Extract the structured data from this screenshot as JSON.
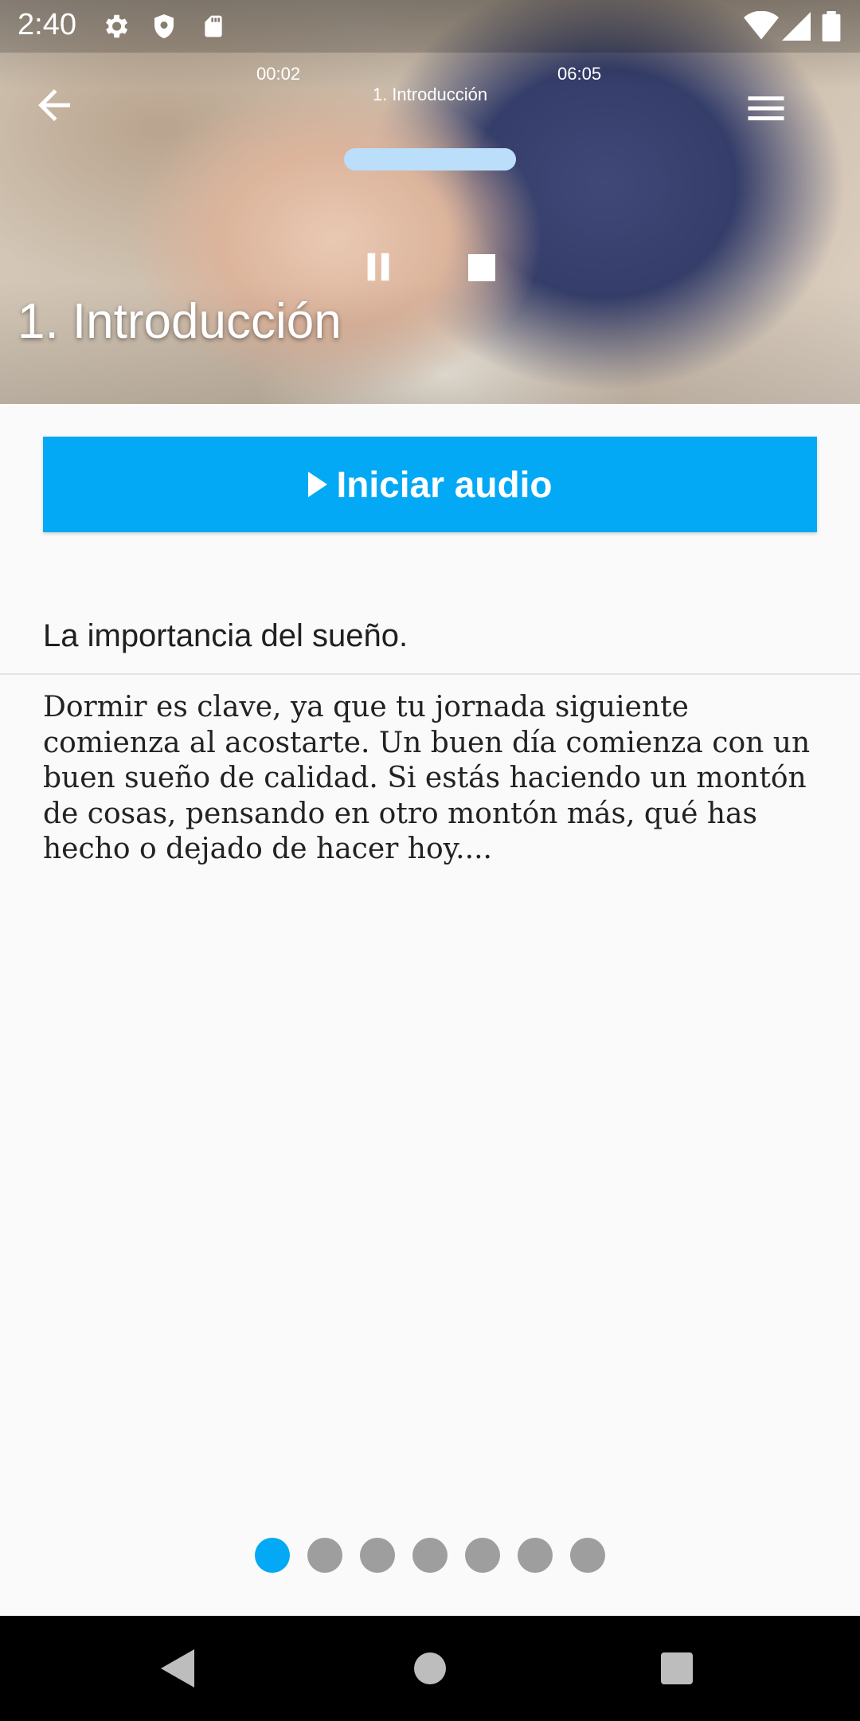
{
  "status_bar": {
    "time": "2:40",
    "icons": [
      "gear-icon",
      "shield-icon",
      "sd-card-icon",
      "wifi-icon",
      "signal-icon",
      "battery-icon"
    ]
  },
  "player": {
    "elapsed": "00:02",
    "track_title": "1. Introducción",
    "total": "06:05",
    "progress_fraction": 0.005
  },
  "hero": {
    "title": "1. Introducción"
  },
  "main": {
    "play_button_label": "Iniciar audio",
    "subtitle": "La importancia del sueño.",
    "body": "Dormir es clave, ya que tu jornada siguiente comienza al acostarte. Un buen día comienza con un buen sueño de calidad. Si estás haciendo un montón de cosas, pensando en otro montón más, qué has hecho o dejado de hacer hoy...."
  },
  "pager": {
    "count": 7,
    "active_index": 0
  },
  "colors": {
    "accent": "#03a9f4",
    "progress_track": "#bbdefb",
    "dot_inactive": "#9e9e9e"
  }
}
